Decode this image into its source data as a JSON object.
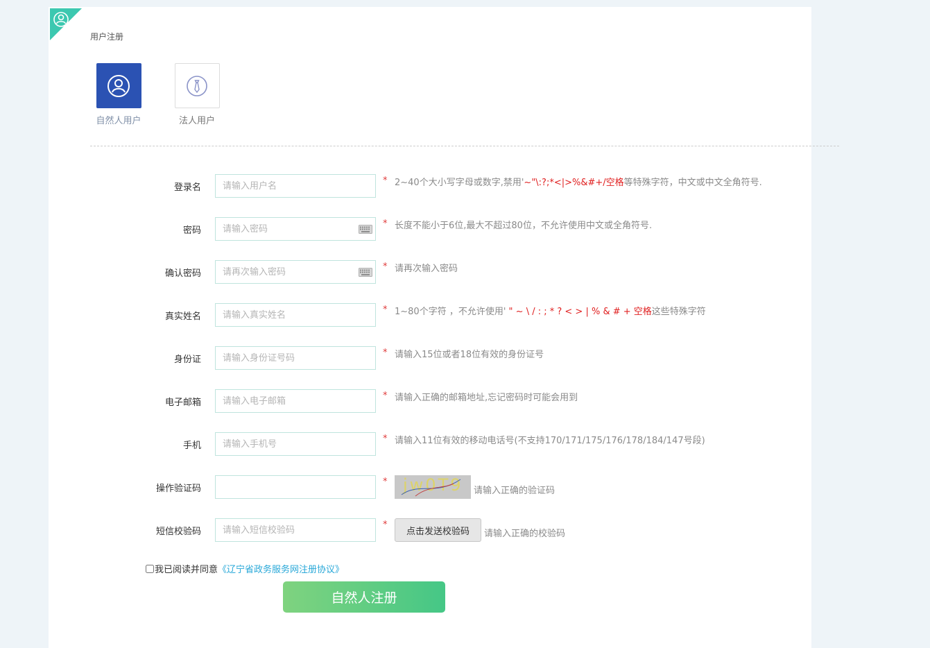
{
  "header": {
    "title": "用户注册"
  },
  "user_types": [
    {
      "label": "自然人用户",
      "icon": "person-icon",
      "selected": true
    },
    {
      "label": "法人用户",
      "icon": "tie-icon",
      "selected": false
    }
  ],
  "form": {
    "username": {
      "label": "登录名",
      "placeholder": "请输入用户名",
      "required": "*",
      "hint_prefix": "2~40个大小写字母或数字,禁用'",
      "hint_red": "~\"\\:?;*<|>%&#+/空格",
      "hint_suffix": "等特殊字符，中文或中文全角符号."
    },
    "password": {
      "label": "密码",
      "placeholder": "请输入密码",
      "required": "*",
      "hint": "长度不能小于6位,最大不超过80位，不允许使用中文或全角符号."
    },
    "confirm_password": {
      "label": "确认密码",
      "placeholder": "请再次输入密码",
      "required": "*",
      "hint": "请再次输入密码"
    },
    "real_name": {
      "label": "真实姓名",
      "placeholder": "请输入真实姓名",
      "required": "*",
      "hint_prefix": "1~80个字符 ，不允许使用'",
      "hint_red": " \" ~ \\ / : ; * ? < > | % & # + 空格",
      "hint_suffix": "这些特殊字符"
    },
    "id_card": {
      "label": "身份证",
      "placeholder": "请输入身份证号码",
      "required": "*",
      "hint": "请输入15位或者18位有效的身份证号"
    },
    "email": {
      "label": "电子邮箱",
      "placeholder": "请输入电子邮箱",
      "required": "*",
      "hint": "请输入正确的邮箱地址,忘记密码时可能会用到"
    },
    "mobile": {
      "label": "手机",
      "placeholder": "请输入手机号",
      "required": "*",
      "hint": "请输入11位有效的移动电话号(不支持170/171/175/176/178/184/147号段)"
    },
    "captcha": {
      "label": "操作验证码",
      "value": "",
      "required": "*",
      "image_text": "jw0T9",
      "hint": "请输入正确的验证码"
    },
    "sms_code": {
      "label": "短信校验码",
      "placeholder": "请输入短信校验码",
      "required": "*",
      "button_label": "点击发送校验码",
      "hint": "请输入正确的校验码"
    }
  },
  "agreement": {
    "text": "我已阅读并同意",
    "link": "《辽宁省政务服务网注册协议》",
    "checked": false
  },
  "submit_label": "自然人注册",
  "colors": {
    "accent_teal": "#3cc8b0",
    "active_blue": "#2b52b3",
    "required_red": "#e03a3a",
    "link_blue": "#29a8d8",
    "button_green_start": "#7fd37f",
    "button_green_end": "#45c786"
  }
}
